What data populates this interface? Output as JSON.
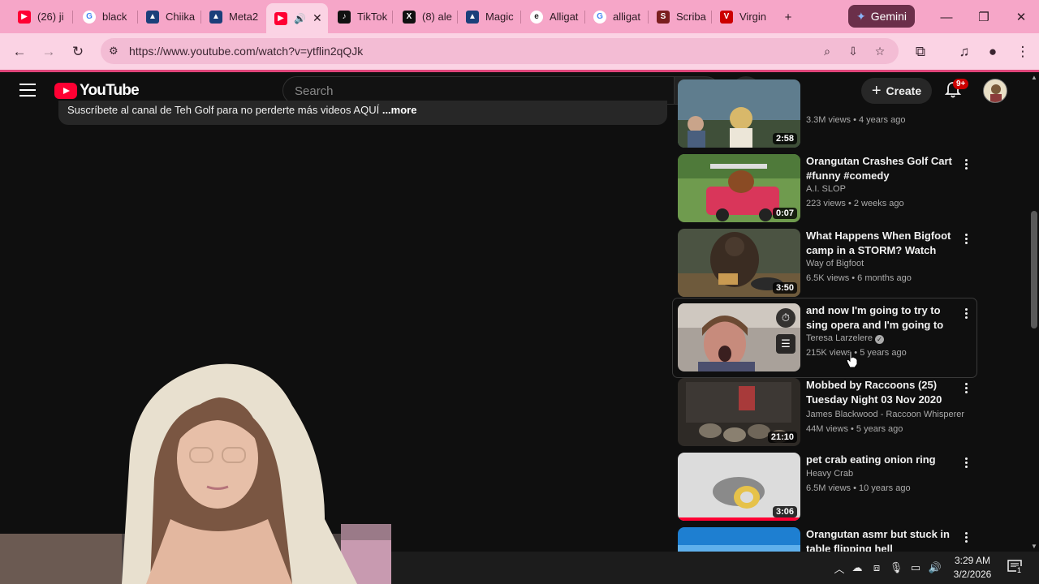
{
  "browser": {
    "tabs": [
      {
        "label": "(26) ji",
        "favicon": "youtube-icon",
        "color": "#ff0033"
      },
      {
        "label": "black",
        "favicon": "google-icon",
        "color": "#4285f4"
      },
      {
        "label": "Chiika",
        "favicon": "meta-ads-icon",
        "color": "#1b3f7a"
      },
      {
        "label": "Meta2",
        "favicon": "meta-ads-icon",
        "color": "#1b3f7a"
      },
      {
        "label": "",
        "favicon": "youtube-icon",
        "color": "#ff0033",
        "active": true
      },
      {
        "label": "TikTok",
        "favicon": "tiktok-icon",
        "color": "#111111"
      },
      {
        "label": "(8) ale",
        "favicon": "x-icon",
        "color": "#111111"
      },
      {
        "label": "Magic",
        "favicon": "meta-ads-icon",
        "color": "#1b3f7a"
      },
      {
        "label": "Alligat",
        "favicon": "e-icon",
        "color": "#222222"
      },
      {
        "label": "alligat",
        "favicon": "google-icon",
        "color": "#4285f4"
      },
      {
        "label": "Scriba",
        "favicon": "scribd-icon",
        "color": "#7a1f1f"
      },
      {
        "label": "Virgin",
        "favicon": "verizon-icon",
        "color": "#cc0000"
      }
    ],
    "new_tab_symbol": "+",
    "gemini_label": "Gemini",
    "url": "https://www.youtube.com/watch?v=ytflin2qQJk"
  },
  "youtube": {
    "logo_text": "YouTube",
    "search_placeholder": "Search",
    "create_label": "Create",
    "notification_badge": "9+",
    "description_snippet": "Suscríbete al canal de Teh Golf para no perderte más videos AQUÍ",
    "description_more": "...more"
  },
  "videos": [
    {
      "title": "",
      "channel": "",
      "meta": "3.3M views • 4 years ago",
      "duration": "2:58"
    },
    {
      "title": "Orangutan Crashes Golf Cart #funny #comedy",
      "channel": "A.I. SLOP",
      "meta": "223 views • 2 weeks ago",
      "duration": "0:07"
    },
    {
      "title": "What Happens When Bigfoot camp in a STORM? Watch This!",
      "channel": "Way of Bigfoot",
      "meta": "6.5K views • 6 months ago",
      "duration": "3:50"
    },
    {
      "title": "and now I'm going to try to sing opera and I'm going to do the ...",
      "channel": "Teresa Larzelere",
      "meta": "215K views • 5 years ago",
      "duration": ""
    },
    {
      "title": "Mobbed by Raccoons  (25) Tuesday Night 03 Nov 2020",
      "channel": "James Blackwood - Raccoon Whisperer",
      "meta": "44M views • 5 years ago",
      "duration": "21:10"
    },
    {
      "title": "pet crab eating onion ring",
      "channel": "Heavy Crab",
      "meta": "6.5M views • 10 years ago",
      "duration": "3:06"
    },
    {
      "title": "Orangutan asmr but stuck in table flipping hell",
      "channel": "",
      "meta": "",
      "duration": ""
    }
  ],
  "taskbar": {
    "time": "3:29 AM",
    "date": "3/2/2026",
    "notification_count": "1"
  }
}
